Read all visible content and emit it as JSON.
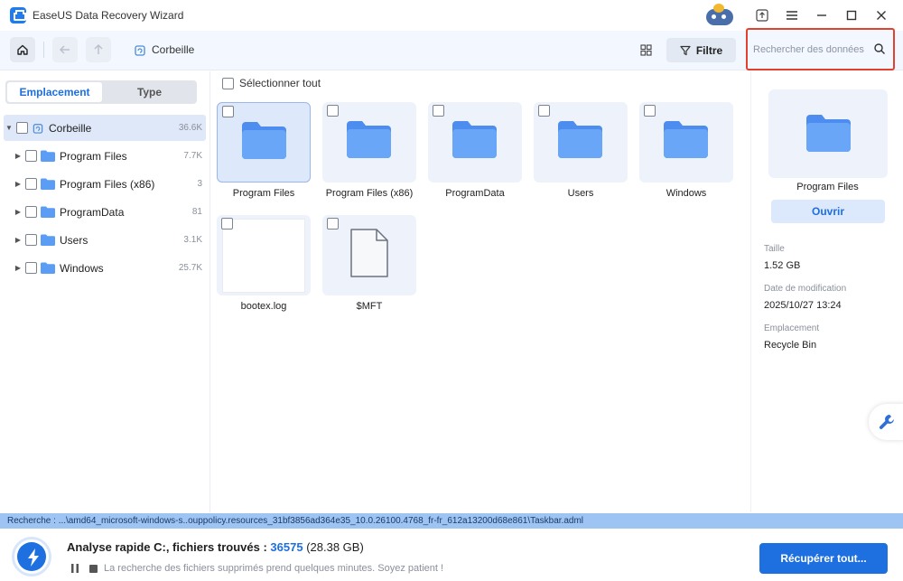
{
  "app": {
    "title": "EaseUS Data Recovery Wizard"
  },
  "toolbar": {
    "breadcrumb": "Corbeille",
    "filter_label": "Filtre",
    "search_placeholder": "Rechercher des données"
  },
  "sidebar": {
    "tabs": [
      "Emplacement",
      "Type"
    ],
    "root": {
      "label": "Corbeille",
      "count": "36.6K"
    },
    "items": [
      {
        "label": "Program Files",
        "count": "7.7K"
      },
      {
        "label": "Program Files (x86)",
        "count": "3"
      },
      {
        "label": "ProgramData",
        "count": "81"
      },
      {
        "label": "Users",
        "count": "3.1K"
      },
      {
        "label": "Windows",
        "count": "25.7K"
      }
    ]
  },
  "content": {
    "select_all": "Sélectionner tout",
    "files": [
      {
        "name": "Program Files",
        "icon": "folder-icon"
      },
      {
        "name": "Program Files (x86)",
        "icon": "folder-icon"
      },
      {
        "name": "ProgramData",
        "icon": "folder-icon"
      },
      {
        "name": "Users",
        "icon": "folder-icon"
      },
      {
        "name": "Windows",
        "icon": "folder-icon"
      },
      {
        "name": "bootex.log",
        "icon": "log-file-thumbnail"
      },
      {
        "name": "$MFT",
        "icon": "document-icon"
      }
    ]
  },
  "details": {
    "name": "Program Files",
    "open_label": "Ouvrir",
    "size_label": "Taille",
    "size_value": "1.52 GB",
    "modified_label": "Date de modification",
    "modified_value": "2025/10/27 13:24",
    "location_label": "Emplacement",
    "location_value": "Recycle Bin"
  },
  "status": {
    "path": "Recherche : ...\\amd64_microsoft-windows-s..ouppolicy.resources_31bf3856ad364e35_10.0.26100.4768_fr-fr_612a13200d68e861\\Taskbar.adml",
    "scan_title_prefix": "Analyse rapide C:, fichiers trouvés : ",
    "found_count": "36575",
    "found_size": "(28.38 GB)",
    "scan_hint": "La recherche des fichiers supprimés prend quelques minutes. Soyez patient !",
    "recover_label": "Récupérer tout..."
  },
  "colors": {
    "accent": "#1e6fe0",
    "folder": "#5b9cf5",
    "highlight": "#e2412f",
    "pathbar": "#9ec4f3"
  }
}
